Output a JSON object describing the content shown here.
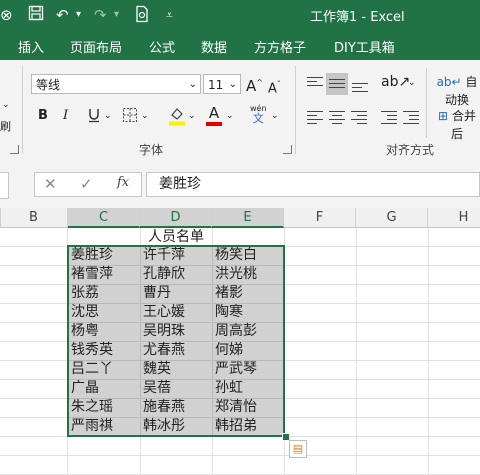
{
  "title": "工作簿1 - Excel",
  "tabs": [
    "插入",
    "页面布局",
    "公式",
    "数据",
    "方方格子",
    "DIY工具箱"
  ],
  "font": {
    "name": "等线",
    "size": "11"
  },
  "ribbon": {
    "font_group_label": "字体",
    "align_group_label": "对齐方式",
    "wrap_label": "自动换",
    "merge_label": "合并后",
    "phonetic_label": "wén",
    "grow_font": "A",
    "shrink_font": "A",
    "bold": "B",
    "italic": "I",
    "font_color": "A"
  },
  "formula": {
    "fx": "fx",
    "cancel": "✕",
    "enter": "✓",
    "content": "姜胜珍"
  },
  "columns": [
    "B",
    "C",
    "D",
    "E",
    "F",
    "G",
    "H"
  ],
  "accent": "#217346",
  "sheet": {
    "heading": "人员名单",
    "rows": [
      [
        "姜胜珍",
        "许千萍",
        "杨笑白"
      ],
      [
        "褚雪萍",
        "孔静欣",
        "洪光桃"
      ],
      [
        "张荔",
        "曹丹",
        "褚影"
      ],
      [
        "沈思",
        "王心媛",
        "陶寒"
      ],
      [
        "杨粤",
        "吴明珠",
        "周高彭"
      ],
      [
        "钱秀英",
        "尤春燕",
        "何娣"
      ],
      [
        "吕二丫",
        "魏英",
        "严武琴"
      ],
      [
        "广晶",
        "吴蓓",
        "孙虹"
      ],
      [
        "朱之瑶",
        "施春燕",
        "郑清怡"
      ],
      [
        "严雨祺",
        "韩冰彤",
        "韩招弟"
      ]
    ]
  }
}
